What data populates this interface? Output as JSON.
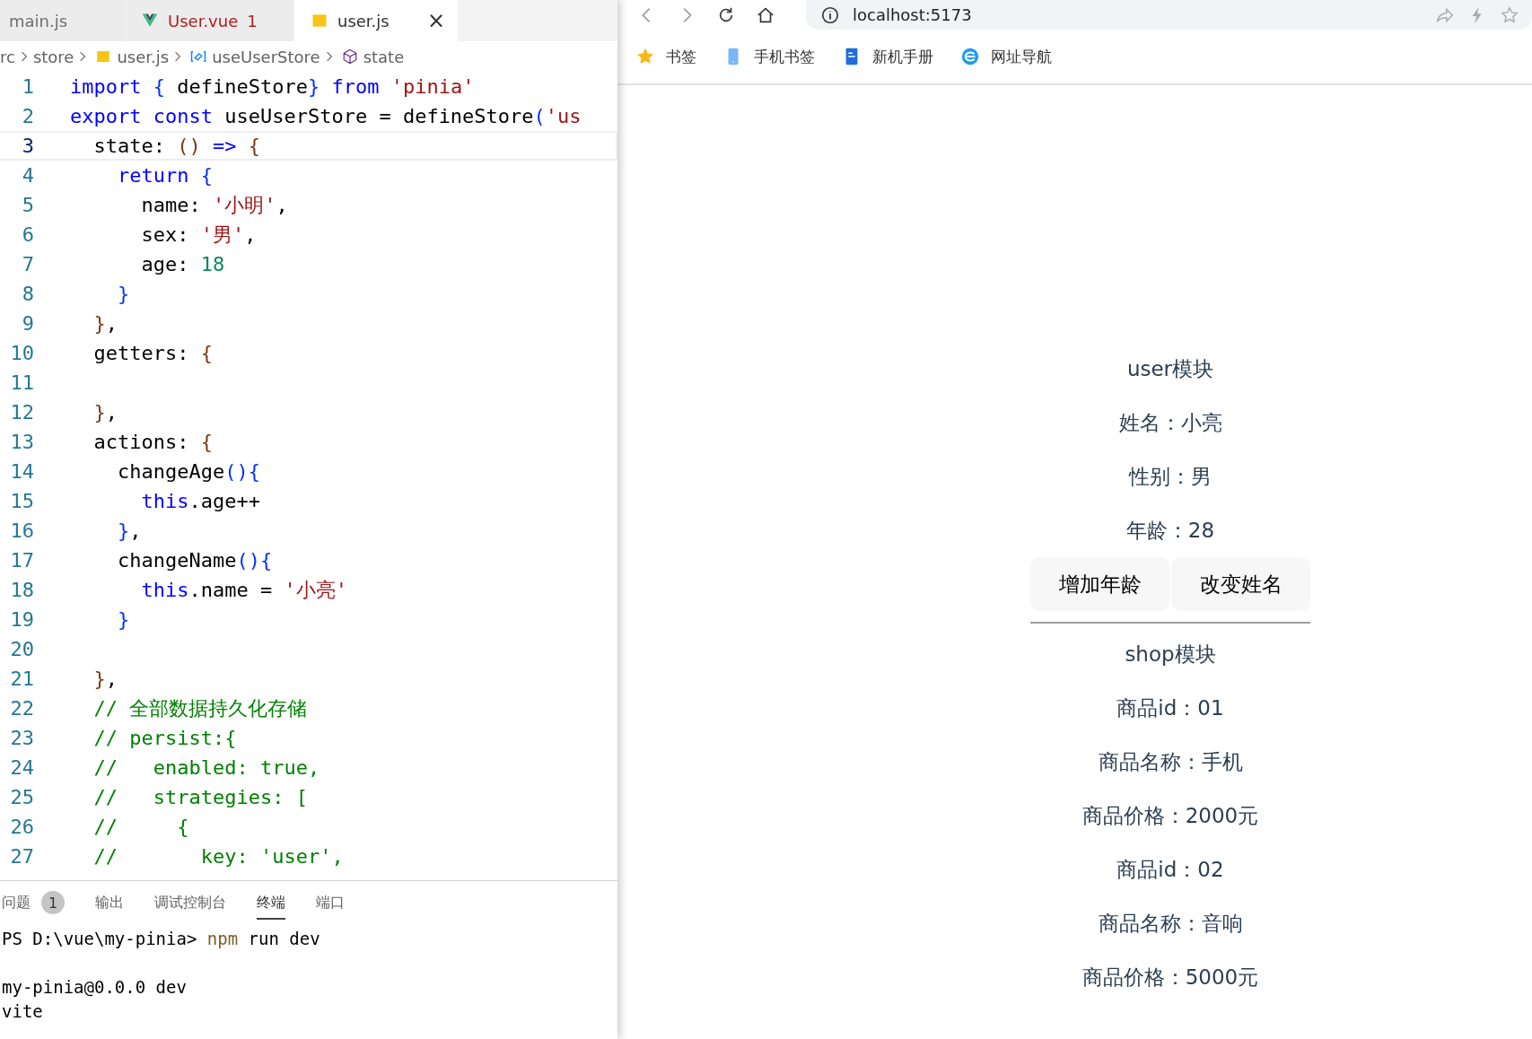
{
  "editor": {
    "tabs": [
      {
        "label": "main.js",
        "kind": "plain",
        "selected": false,
        "error": false
      },
      {
        "label": "User.vue",
        "kind": "vue",
        "selected": false,
        "error": true,
        "problems": "1"
      },
      {
        "label": "user.js",
        "kind": "js",
        "selected": true,
        "error": false,
        "close": "×"
      }
    ],
    "breadcrumb": [
      {
        "label": "rc",
        "kind": "plain"
      },
      {
        "label": "store",
        "kind": "plain"
      },
      {
        "label": "user.js",
        "kind": "js"
      },
      {
        "label": "useUserStore",
        "kind": "variable"
      },
      {
        "label": "state",
        "kind": "property"
      }
    ],
    "lines": [
      {
        "number": "1",
        "current": false,
        "tokens": [
          {
            "t": "import",
            "kind": "keyword"
          },
          {
            "t": " {",
            "kind": "bracket"
          },
          {
            "t": " defineStore",
            "kind": "plain"
          },
          {
            "t": "}",
            "kind": "bracket"
          },
          {
            "t": " from",
            "kind": "keyword"
          },
          {
            "t": " 'pinia'",
            "kind": "string"
          }
        ]
      },
      {
        "number": "2",
        "current": false,
        "tokens": [
          {
            "t": "export",
            "kind": "keyword"
          },
          {
            "t": " const",
            "kind": "keyword"
          },
          {
            "t": " useUserStore = defineStore",
            "kind": "plain"
          },
          {
            "t": "(",
            "kind": "bracket"
          },
          {
            "t": "'us",
            "kind": "string"
          }
        ]
      },
      {
        "number": "3",
        "current": true,
        "tokens": [
          {
            "t": "  state: ",
            "kind": "plain"
          },
          {
            "t": "()",
            "kind": "outer"
          },
          {
            "t": " =>",
            "kind": "keyword"
          },
          {
            "t": " {",
            "kind": "outer"
          }
        ]
      },
      {
        "number": "4",
        "current": false,
        "tokens": [
          {
            "t": "    return",
            "kind": "keyword"
          },
          {
            "t": " {",
            "kind": "bracket"
          }
        ]
      },
      {
        "number": "5",
        "current": false,
        "tokens": [
          {
            "t": "      name: ",
            "kind": "plain"
          },
          {
            "t": "'小明'",
            "kind": "string"
          },
          {
            "t": ",",
            "kind": "plain"
          }
        ]
      },
      {
        "number": "6",
        "current": false,
        "tokens": [
          {
            "t": "      sex: ",
            "kind": "plain"
          },
          {
            "t": "'男'",
            "kind": "string"
          },
          {
            "t": ",",
            "kind": "plain"
          }
        ]
      },
      {
        "number": "7",
        "current": false,
        "tokens": [
          {
            "t": "      age: ",
            "kind": "plain"
          },
          {
            "t": "18",
            "kind": "number"
          }
        ]
      },
      {
        "number": "8",
        "current": false,
        "tokens": [
          {
            "t": "    }",
            "kind": "bracket"
          }
        ]
      },
      {
        "number": "9",
        "current": false,
        "tokens": [
          {
            "t": "  }",
            "kind": "outer"
          },
          {
            "t": ",",
            "kind": "plain"
          }
        ]
      },
      {
        "number": "10",
        "current": false,
        "tokens": [
          {
            "t": "  getters: ",
            "kind": "plain"
          },
          {
            "t": "{",
            "kind": "outer"
          }
        ]
      },
      {
        "number": "11",
        "current": false
      },
      {
        "number": "12",
        "current": false,
        "tokens": [
          {
            "t": "  }",
            "kind": "outer"
          },
          {
            "t": ",",
            "kind": "plain"
          }
        ]
      },
      {
        "number": "13",
        "current": false,
        "tokens": [
          {
            "t": "  actions: ",
            "kind": "plain"
          },
          {
            "t": "{",
            "kind": "outer"
          }
        ]
      },
      {
        "number": "14",
        "current": false,
        "tokens": [
          {
            "t": "    changeAge",
            "kind": "plain"
          },
          {
            "t": "(){",
            "kind": "bracket"
          }
        ]
      },
      {
        "number": "15",
        "current": false,
        "tokens": [
          {
            "t": "      this",
            "kind": "keyword"
          },
          {
            "t": ".age++",
            "kind": "plain"
          }
        ]
      },
      {
        "number": "16",
        "current": false,
        "tokens": [
          {
            "t": "    }",
            "kind": "bracket"
          },
          {
            "t": ",",
            "kind": "plain"
          }
        ]
      },
      {
        "number": "17",
        "current": false,
        "tokens": [
          {
            "t": "    changeName",
            "kind": "plain"
          },
          {
            "t": "(){",
            "kind": "bracket"
          }
        ]
      },
      {
        "number": "18",
        "current": false,
        "tokens": [
          {
            "t": "      this",
            "kind": "keyword"
          },
          {
            "t": ".name = ",
            "kind": "plain"
          },
          {
            "t": "'小亮'",
            "kind": "string"
          }
        ]
      },
      {
        "number": "19",
        "current": false,
        "tokens": [
          {
            "t": "    }",
            "kind": "bracket"
          }
        ]
      },
      {
        "number": "20",
        "current": false
      },
      {
        "number": "21",
        "current": false,
        "tokens": [
          {
            "t": "  }",
            "kind": "outer"
          },
          {
            "t": ",",
            "kind": "plain"
          }
        ]
      },
      {
        "number": "22",
        "current": false,
        "tokens": [
          {
            "t": "  // 全部数据持久化存储",
            "kind": "comment"
          }
        ]
      },
      {
        "number": "23",
        "current": false,
        "tokens": [
          {
            "t": "  // persist:{",
            "kind": "comment"
          }
        ]
      },
      {
        "number": "24",
        "current": false,
        "tokens": [
          {
            "t": "  //   enabled: true,",
            "kind": "comment"
          }
        ]
      },
      {
        "number": "25",
        "current": false,
        "tokens": [
          {
            "t": "  //   strategies: [",
            "kind": "comment"
          }
        ]
      },
      {
        "number": "26",
        "current": false,
        "tokens": [
          {
            "t": "  //     {",
            "kind": "comment"
          }
        ]
      },
      {
        "number": "27",
        "current": false,
        "tokens": [
          {
            "t": "  //       key: 'user',",
            "kind": "comment"
          }
        ]
      }
    ]
  },
  "panel": {
    "tabs": [
      {
        "label": "问题",
        "selected": false,
        "badge": "1"
      },
      {
        "label": "输出",
        "selected": false
      },
      {
        "label": "调试控制台",
        "selected": false
      },
      {
        "label": "终端",
        "selected": true
      },
      {
        "label": "端口",
        "selected": false
      }
    ],
    "terminal": [
      {
        "tokens": [
          {
            "t": "PS D:\\vue\\my-pinia> ",
            "kind": "plain"
          },
          {
            "t": "npm",
            "kind": "command"
          },
          {
            "t": " run dev",
            "kind": "plain"
          }
        ]
      },
      {
        "tokens": [
          {
            "t": "my-pinia@0.0.0 dev",
            "kind": "plain"
          }
        ]
      },
      {
        "tokens": [
          {
            "t": "vite",
            "kind": "plain"
          }
        ]
      }
    ]
  },
  "browser": {
    "url": "localhost:5173",
    "bookmarks": [
      {
        "label": "书签",
        "kind": "star"
      },
      {
        "label": "手机书签",
        "kind": "phone"
      },
      {
        "label": "新机手册",
        "kind": "doc"
      },
      {
        "label": "网址导航",
        "kind": "globe"
      }
    ],
    "page": {
      "user_title": "user模块",
      "user_fields": [
        {
          "label": "姓名：",
          "value": "小亮"
        },
        {
          "label": "性别：",
          "value": "男"
        },
        {
          "label": "年龄：",
          "value": "28"
        }
      ],
      "buttons": [
        "增加年龄",
        "改变姓名"
      ],
      "shop_title": "shop模块",
      "shop_fields": [
        {
          "label": "商品id：",
          "value": "01"
        },
        {
          "label": "商品名称：",
          "value": "手机"
        },
        {
          "label": "商品价格：",
          "value": "2000元"
        },
        {
          "label": "商品id：",
          "value": "02"
        },
        {
          "label": "商品名称：",
          "value": "音响"
        },
        {
          "label": "商品价格：",
          "value": "5000元"
        }
      ]
    }
  }
}
